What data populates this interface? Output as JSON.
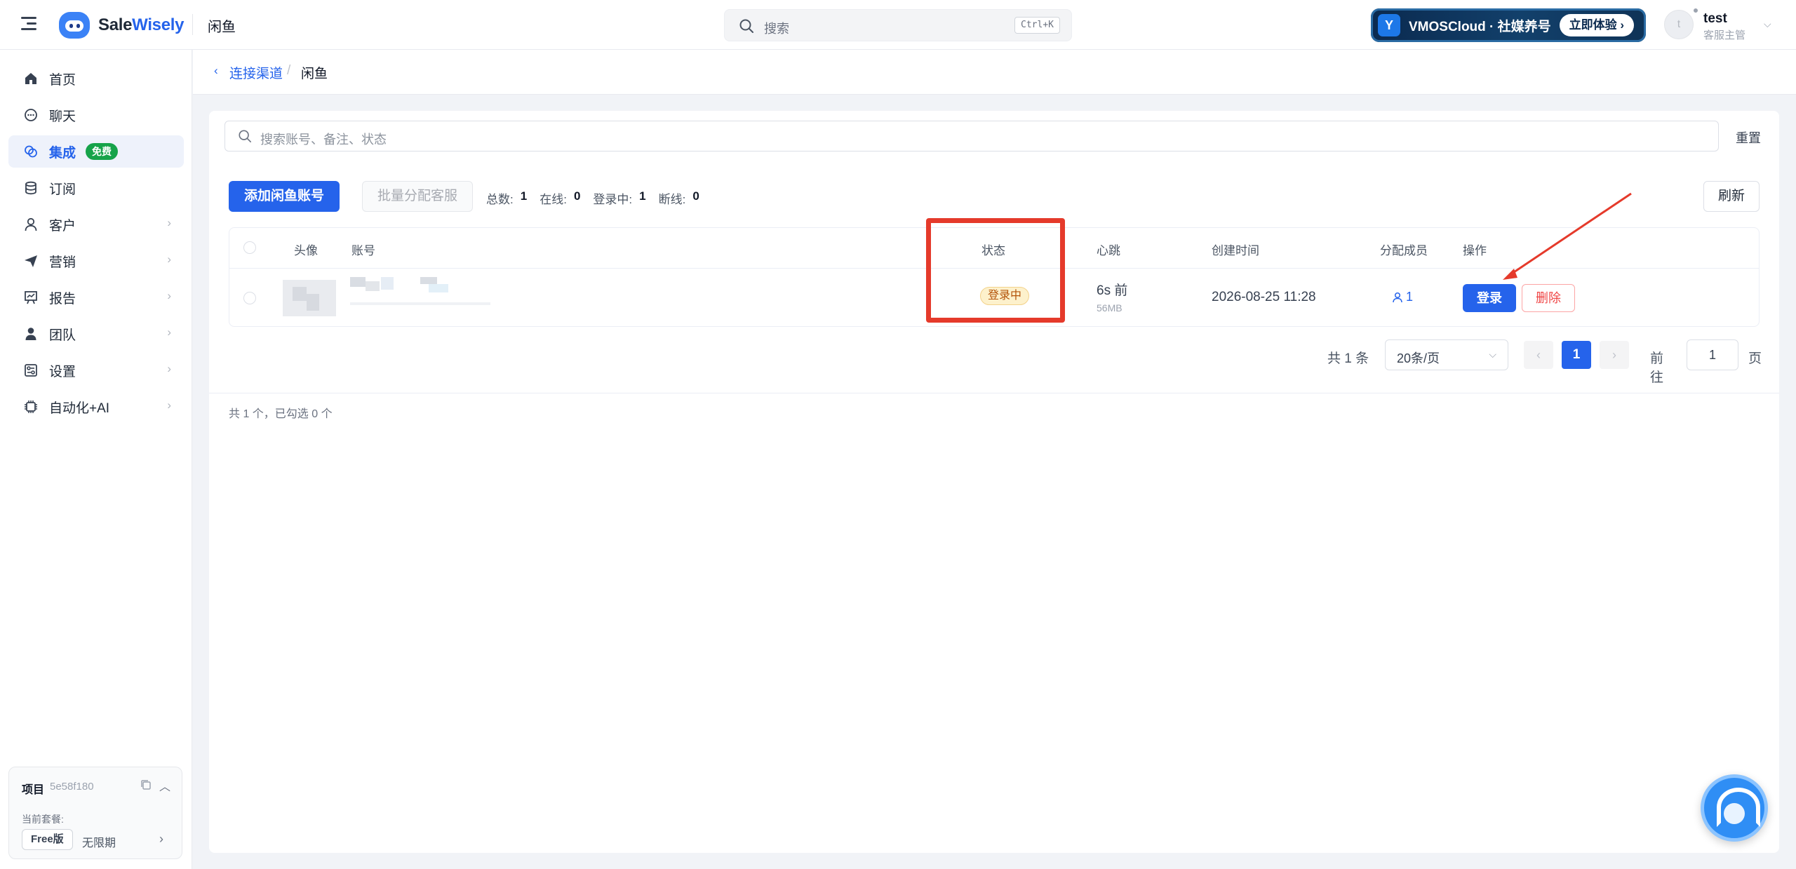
{
  "header": {
    "brand": "SaleWisely",
    "brand_prefix": "Sale",
    "brand_suffix": "Wisely",
    "current_page": "闲鱼",
    "search_placeholder": "搜索",
    "search_shortcut": "Ctrl+K",
    "promo": {
      "text": "VMOSCloud · 社媒养号",
      "button": "立即体验 ›"
    },
    "user": {
      "name": "test",
      "role": "客服主管",
      "initial": "t"
    }
  },
  "sidebar": {
    "items": [
      {
        "label": "首页",
        "icon": "home-icon"
      },
      {
        "label": "聊天",
        "icon": "chat-icon"
      },
      {
        "label": "集成",
        "icon": "integration-icon",
        "badge": "免费",
        "active": true
      },
      {
        "label": "订阅",
        "icon": "database-icon"
      },
      {
        "label": "客户",
        "icon": "user-icon",
        "has_children": true
      },
      {
        "label": "营销",
        "icon": "send-icon",
        "has_children": true
      },
      {
        "label": "报告",
        "icon": "report-icon",
        "has_children": true
      },
      {
        "label": "团队",
        "icon": "team-icon",
        "has_children": true
      },
      {
        "label": "设置",
        "icon": "settings-icon",
        "has_children": true
      },
      {
        "label": "自动化+AI",
        "icon": "chip-icon",
        "has_children": true
      }
    ],
    "project": {
      "label": "项目",
      "id": "5e58f180",
      "plan_label": "当前套餐:",
      "plan_name": "Free版",
      "plan_term": "无限期"
    }
  },
  "breadcrumb": {
    "parent": "连接渠道",
    "separator": "/",
    "current": "闲鱼"
  },
  "toolbar": {
    "search_placeholder": "搜索账号、备注、状态",
    "reset": "重置",
    "add_button": "添加闲鱼账号",
    "batch_button": "批量分配客服",
    "refresh": "刷新",
    "stats": [
      {
        "label": "总数:",
        "value": "1"
      },
      {
        "label": "在线:",
        "value": "0"
      },
      {
        "label": "登录中:",
        "value": "1"
      },
      {
        "label": "断线:",
        "value": "0"
      }
    ]
  },
  "table": {
    "columns": [
      "头像",
      "账号",
      "状态",
      "心跳",
      "创建时间",
      "分配成员",
      "操作"
    ],
    "rows": [
      {
        "status": "登录中",
        "heartbeat": "6s 前",
        "memory": "56MB",
        "created": "2026-08-25 11:28",
        "members": "1",
        "actions": {
          "login": "登录",
          "delete": "删除"
        }
      }
    ]
  },
  "pagination": {
    "total": "共 1 条",
    "page_size": "20条/页",
    "current_page": "1",
    "goto_label": "前往",
    "goto_value": "1",
    "page_suffix": "页"
  },
  "footer_note": "共 1 个，已勾选 0 个",
  "colors": {
    "accent": "#2563eb",
    "highlight": "#e53a2b",
    "badge_green": "#16a34a",
    "status_pending": "#b45309"
  }
}
